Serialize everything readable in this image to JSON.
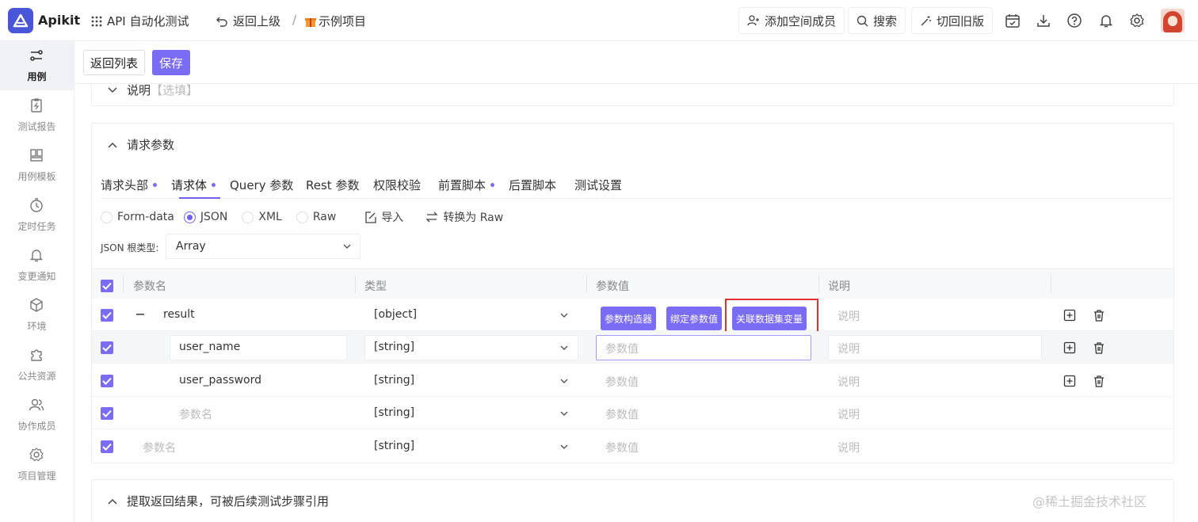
{
  "header": {
    "brand": "Apikit",
    "module": "API 自动化测试",
    "back_up": "返回上级",
    "separator": "/",
    "project": "示例项目",
    "add_member": "添加空间成员",
    "search": "搜索",
    "switch_old": "切回旧版"
  },
  "sidebar": {
    "items": [
      {
        "label": "用例",
        "icon": "test-case-icon"
      },
      {
        "label": "测试报告",
        "icon": "report-icon"
      },
      {
        "label": "用例模板",
        "icon": "template-icon"
      },
      {
        "label": "定时任务",
        "icon": "timer-icon"
      },
      {
        "label": "变更通知",
        "icon": "bell-icon"
      },
      {
        "label": "环境",
        "icon": "cube-icon"
      },
      {
        "label": "公共资源",
        "icon": "puzzle-icon"
      },
      {
        "label": "协作成员",
        "icon": "members-icon"
      },
      {
        "label": "项目管理",
        "icon": "gear-icon"
      }
    ]
  },
  "actions": {
    "back_list": "返回列表",
    "save": "保存"
  },
  "desc_section": {
    "title": "说明",
    "optional": "【选填】"
  },
  "request_section": {
    "title": "请求参数",
    "tabs": [
      {
        "label": "请求头部",
        "dot": true
      },
      {
        "label": "请求体",
        "dot": true
      },
      {
        "label": "Query 参数",
        "dot": false
      },
      {
        "label": "Rest 参数",
        "dot": false
      },
      {
        "label": "权限校验",
        "dot": false
      },
      {
        "label": "前置脚本",
        "dot": true
      },
      {
        "label": "后置脚本",
        "dot": false
      },
      {
        "label": "测试设置",
        "dot": false
      }
    ],
    "formats": [
      "Form-data",
      "JSON",
      "XML",
      "Raw"
    ],
    "selected_format": "JSON",
    "import_label": "导入",
    "convert_label": "转换为 Raw",
    "root_type_label": "JSON 根类型:",
    "root_type_value": "Array",
    "columns": [
      "参数名",
      "类型",
      "参数值",
      "说明"
    ],
    "value_buttons": [
      "参数构造器",
      "绑定参数值",
      "关联数据集变量"
    ],
    "placeholders": {
      "name": "参数名",
      "value": "参数值",
      "desc": "说明"
    },
    "rows": [
      {
        "name": "result",
        "type": "[object]"
      },
      {
        "name": "user_name",
        "type": "[string]"
      },
      {
        "name": "user_password",
        "type": "[string]"
      },
      {
        "name": "",
        "type": "[string]"
      },
      {
        "name": "",
        "type": "[string]"
      }
    ]
  },
  "extract_section": {
    "title": "提取返回结果，可被后续测试步骤引用"
  },
  "watermark": "@稀土掘金技术社区",
  "colors": {
    "accent": "#7b6cf6",
    "highlight_border": "#e03030"
  }
}
